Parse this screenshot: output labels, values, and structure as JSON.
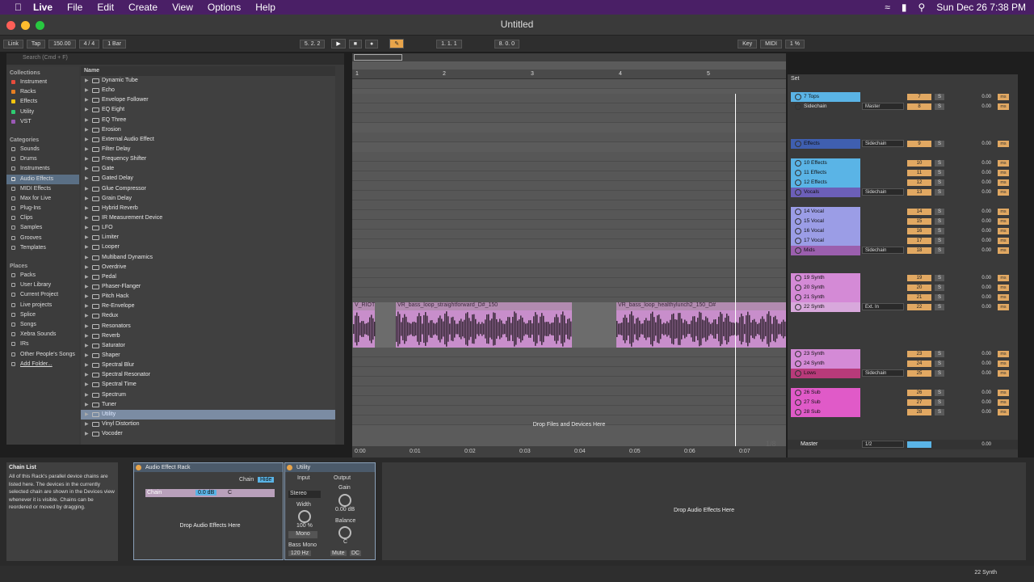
{
  "menubar": {
    "app": "Live",
    "items": [
      "File",
      "Edit",
      "Create",
      "View",
      "Options",
      "Help"
    ],
    "clock": "Sun Dec 26  7:38 PM"
  },
  "window": {
    "title": "Untitled"
  },
  "control_bar": {
    "link": "Link",
    "tap": "Tap",
    "tempo": "150.00",
    "meter": "4 / 4",
    "quantize": "1 Bar",
    "position": "5.   2.   2",
    "loop_start": "1.   1.   1",
    "loop_length": "8.   0.   0",
    "key": "Key",
    "midi": "MIDI",
    "cpu": "1 %"
  },
  "browser": {
    "search_placeholder": "Search (Cmd + F)",
    "name_header": "Name",
    "collections_title": "Collections",
    "collections": [
      {
        "label": "Instrument",
        "color": "#e74c3c"
      },
      {
        "label": "Racks",
        "color": "#e67e22"
      },
      {
        "label": "Effects",
        "color": "#f1c40f"
      },
      {
        "label": "Utility",
        "color": "#2ecc71"
      },
      {
        "label": "VST",
        "color": "#9b59b6"
      }
    ],
    "categories_title": "Categories",
    "categories": [
      "Sounds",
      "Drums",
      "Instruments",
      "Audio Effects",
      "MIDI Effects",
      "Max for Live",
      "Plug-Ins",
      "Clips",
      "Samples",
      "Grooves",
      "Templates"
    ],
    "places_title": "Places",
    "places": [
      "Packs",
      "User Library",
      "Current Project",
      "Live projects",
      "Splice",
      "Songs",
      "Xebra Sounds",
      "IRs",
      "Other People's Songs",
      "Add Folder..."
    ],
    "items": [
      "Dynamic Tube",
      "Echo",
      "Envelope Follower",
      "EQ Eight",
      "EQ Three",
      "Erosion",
      "External Audio Effect",
      "Filter Delay",
      "Frequency Shifter",
      "Gate",
      "Gated Delay",
      "Glue Compressor",
      "Grain Delay",
      "Hybrid Reverb",
      "IR Measurement Device",
      "LFO",
      "Limiter",
      "Looper",
      "Multiband Dynamics",
      "Overdrive",
      "Pedal",
      "Phaser-Flanger",
      "Pitch Hack",
      "Re-Envelope",
      "Redux",
      "Resonators",
      "Reverb",
      "Saturator",
      "Shaper",
      "Spectral Blur",
      "Spectral Resonator",
      "Spectral Time",
      "Spectrum",
      "Tuner",
      "Utility",
      "Vinyl Distortion",
      "Vocoder"
    ]
  },
  "arrangement": {
    "bars": [
      "1",
      "2",
      "3",
      "4",
      "5"
    ],
    "times": [
      "0:00",
      "0:01",
      "0:02",
      "0:03",
      "0:04",
      "0:05",
      "0:06",
      "0:07"
    ],
    "clips": [
      "V_RIOT",
      "VR_bass_loop_straightforward_D#_150",
      "VR_bass_loop_healthylunch2_150_D#"
    ],
    "drop_text": "Drop Files and Devices Here",
    "page": "1/8"
  },
  "mixer": {
    "set": "Set",
    "tracks": [
      {
        "name": "7 Tops",
        "color": "#5ab4e6",
        "num": "7",
        "input": "",
        "vol": "0.00"
      },
      {
        "name": "Sidechain",
        "color": "#3a3a3a",
        "num": "8",
        "input": "Master",
        "vol": "0.00"
      },
      {
        "name": "Effects",
        "color": "#3f5fb0",
        "num": "9",
        "input": "Sidechain",
        "vol": "0.00"
      },
      {
        "name": "10 Effects",
        "color": "#5ab4e6",
        "num": "10",
        "input": "",
        "vol": "0.00"
      },
      {
        "name": "11 Effects",
        "color": "#5ab4e6",
        "num": "11",
        "input": "",
        "vol": "0.00"
      },
      {
        "name": "12 Effects",
        "color": "#5ab4e6",
        "num": "12",
        "input": "",
        "vol": "0.00"
      },
      {
        "name": "Vocals",
        "color": "#6c5fb8",
        "num": "13",
        "input": "Sidechain",
        "vol": "0.00"
      },
      {
        "name": "14 Vocal",
        "color": "#9b9de6",
        "num": "14",
        "input": "",
        "vol": "0.00"
      },
      {
        "name": "15 Vocal",
        "color": "#9b9de6",
        "num": "15",
        "input": "",
        "vol": "0.00"
      },
      {
        "name": "16 Vocal",
        "color": "#9b9de6",
        "num": "16",
        "input": "",
        "vol": "0.00"
      },
      {
        "name": "17 Vocal",
        "color": "#9b9de6",
        "num": "17",
        "input": "",
        "vol": "0.00"
      },
      {
        "name": "Mids",
        "color": "#9b5fae",
        "num": "18",
        "input": "Sidechain",
        "vol": "0.00"
      },
      {
        "name": "19 Synth",
        "color": "#d48ad6",
        "num": "19",
        "input": "",
        "vol": "0.00"
      },
      {
        "name": "20 Synth",
        "color": "#d48ad6",
        "num": "20",
        "input": "",
        "vol": "0.00"
      },
      {
        "name": "21 Synth",
        "color": "#d48ad6",
        "num": "21",
        "input": "",
        "vol": "0.00"
      },
      {
        "name": "22 Synth",
        "color": "#d8a8dc",
        "num": "22",
        "input": "Ext. In",
        "vol": "0.00"
      },
      {
        "name": "23 Synth",
        "color": "#d48ad6",
        "num": "23",
        "input": "",
        "vol": "0.00"
      },
      {
        "name": "24 Synth",
        "color": "#d48ad6",
        "num": "24",
        "input": "",
        "vol": "0.00"
      },
      {
        "name": "Lows",
        "color": "#b83a7a",
        "num": "25",
        "input": "Sidechain",
        "vol": "0.00"
      },
      {
        "name": "26 Sub",
        "color": "#e05ac8",
        "num": "26",
        "input": "",
        "vol": "0.00"
      },
      {
        "name": "27 Sub",
        "color": "#e05ac8",
        "num": "27",
        "input": "",
        "vol": "0.00"
      },
      {
        "name": "28 Sub",
        "color": "#e05ac8",
        "num": "28",
        "input": "",
        "vol": "0.00"
      }
    ],
    "master": {
      "name": "Master",
      "input": "1/2",
      "vol": "0.00"
    }
  },
  "info_view": {
    "title": "Chain List",
    "text": "All of this Rack's parallel device chains are listed here. The devices in the currently selected chain are shown in the Devices view whenever it is visible. Chains can be reordered or moved by dragging."
  },
  "rack": {
    "title": "Audio Effect Rack",
    "chain_label": "Chain",
    "hide": "Hide",
    "chain_name": "Chain",
    "chain_vol": "0.0 dB",
    "chain_pan": "C",
    "drop_text": "Drop Audio Effects Here"
  },
  "utility": {
    "title": "Utility",
    "input": "Input",
    "output": "Output",
    "stereo": "Stereo",
    "gain": "Gain",
    "gain_value": "0.00 dB",
    "width": "Width",
    "width_value": "100 %",
    "balance": "Balance",
    "balance_value": "C",
    "mono": "Mono",
    "bass_mono": "Bass Mono",
    "bass_freq": "120 Hz",
    "mute": "Mute",
    "dc": "DC"
  },
  "device_drop": "Drop Audio Effects Here",
  "status": {
    "selected_track": "22 Synth"
  }
}
